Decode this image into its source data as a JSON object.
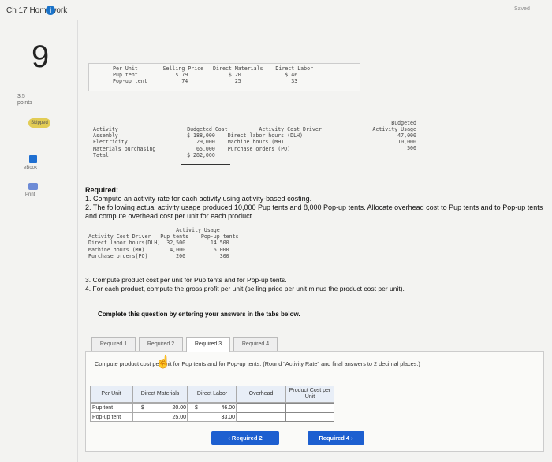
{
  "header": {
    "title": "Ch 17 Homework",
    "saved": "Saved"
  },
  "sidebar": {
    "question_number": "9",
    "points": "3.5\npoints",
    "skipped": "Skipped",
    "ebook": "eBook",
    "print": "Print"
  },
  "price_table": {
    "text": "Per Unit        Selling Price   Direct Materials    Direct Labor\nPup tent            $ 79             $ 20              $ 46\nPop-up tent           74               25                33"
  },
  "activity_cost": {
    "text": "Activity                      Budgeted Cost          Activity Cost Driver\nAssembly                      $ 188,000    Direct labor hours (DLH)\nElectricity                      29,000    Machine hours (MH)\nMaterials purchasing             65,000    Purchase orders (PO)\nTotal                         $ 282,000",
    "usage_header": "Budgeted\nActivity Usage",
    "usage_values": "47,000\n10,000\n500"
  },
  "required": {
    "heading": "Required:",
    "item1": "1. Compute an activity rate for each activity using activity-based costing.",
    "item2": "2. The following actual activity usage produced 10,000 Pup tents and 8,000 Pop-up tents. Allocate overhead cost to Pup tents and to Pop-up tents and compute overhead cost per unit for each product.",
    "item3": "3. Compute product cost per unit for Pup tents and for Pop-up tents.",
    "item4": "4. For each product, compute the gross profit per unit (selling price per unit minus the product cost per unit).",
    "complete": "Complete this question by entering your answers in the tabs below."
  },
  "actual_usage": {
    "text": "                            Activity Usage\nActivity Cost Driver   Pup tents    Pop-up tents\nDirect labor hours(DLH)  32,500        14,500\nMachine hours (MH)        4,000         6,000\nPurchase orders(PO)         200           300"
  },
  "tabs": [
    "Required 1",
    "Required 2",
    "Required 3",
    "Required 4"
  ],
  "panel": {
    "instruction": "Compute product cost per unit for Pup tents and for Pop-up tents. (Round \"Activity Rate\" and final answers to 2 decimal places.)",
    "columns": [
      "Per Unit",
      "Direct Materials",
      "Direct Labor",
      "Overhead",
      "Product Cost per Unit"
    ],
    "rows": [
      {
        "label": "Pup tent",
        "dm_sign": "$",
        "dm": "20.00",
        "dl_sign": "$",
        "dl": "46.00",
        "oh": "",
        "pc": ""
      },
      {
        "label": "Pop-up tent",
        "dm_sign": "",
        "dm": "25.00",
        "dl_sign": "",
        "dl": "33.00",
        "oh": "",
        "pc": ""
      }
    ]
  },
  "nav": {
    "prev": "‹ Required 2",
    "next": "Required 4 ›"
  },
  "colors": {
    "accent": "#1d5fd0",
    "skipped": "#e2cc55"
  }
}
